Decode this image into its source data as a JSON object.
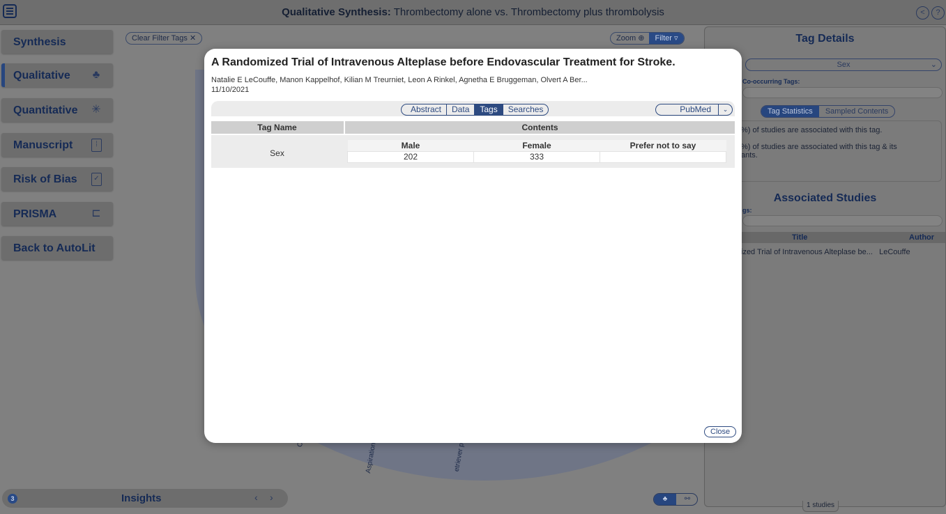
{
  "app": {
    "title_bold": "Qualitative Synthesis:",
    "title_rest": "Thrombectomy alone vs. Thrombectomy plus thrombolysis"
  },
  "sidebar": {
    "items": [
      {
        "label": "Synthesis"
      },
      {
        "label": "Qualitative"
      },
      {
        "label": "Quantitative"
      },
      {
        "label": "Manuscript"
      },
      {
        "label": "Risk of Bias"
      },
      {
        "label": "PRISMA"
      },
      {
        "label": "Back to AutoLit"
      }
    ]
  },
  "toolbar": {
    "clear_filter": "Clear Filter Tags",
    "zoom": "Zoom",
    "filter": "Filter"
  },
  "chart_fragments": [
    "Co",
    "Aspiration",
    "etriever pl"
  ],
  "right_panel": {
    "heading": "Tag Details",
    "selected_tag": "Sex",
    "cooccurring_label": "Co-occurring Tags:",
    "toggle": [
      "Tag Statistics",
      "Sampled Contents"
    ],
    "stat_line1": "%) of studies are associated with this tag.",
    "stat_line2a": "%) of studies are associated with this tag & its",
    "stat_line2b": "ants.",
    "assoc_heading": "Associated Studies",
    "tags_label": "gs:",
    "table_headers": [
      "Title",
      "Author"
    ],
    "rows": [
      {
        "title": "ized Trial of Intravenous Alteplase be...",
        "author": "LeCouffe"
      }
    ],
    "footer": "1 studies"
  },
  "insights": {
    "count": "3",
    "label": "Insights"
  },
  "modal": {
    "title": "A Randomized Trial of Intravenous Alteplase before Endovascular Treatment for Stroke.",
    "authors": "Natalie E LeCouffe, Manon Kappelhof, Kilian M Treurniet, Leon A Rinkel, Agnetha E Bruggeman, Olvert A Ber...",
    "date": "11/10/2021",
    "tabs": [
      "Abstract",
      "Data",
      "Tags",
      "Searches"
    ],
    "active_tab": "Tags",
    "source": "PubMed",
    "table": {
      "col_tag": "Tag Name",
      "col_contents": "Contents",
      "rows": [
        {
          "tag": "Sex",
          "headers": [
            "Male",
            "Female",
            "Prefer not to say"
          ],
          "values": [
            "202",
            "333",
            ""
          ]
        }
      ]
    },
    "close": "Close"
  }
}
